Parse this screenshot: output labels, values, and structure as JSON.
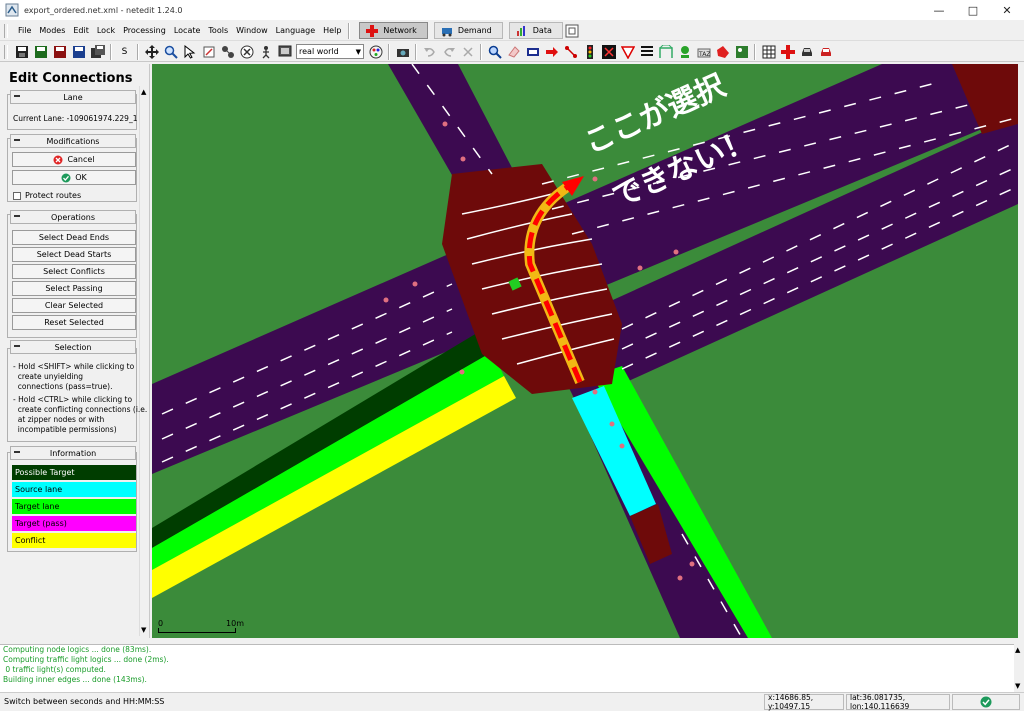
{
  "window": {
    "title": "export_ordered.net.xml - netedit 1.24.0",
    "controls": [
      "minimize-icon",
      "maximize-icon",
      "close-icon"
    ]
  },
  "menu": {
    "items": [
      "File",
      "Modes",
      "Edit",
      "Lock",
      "Processing",
      "Locate",
      "Tools",
      "Window",
      "Language",
      "Help"
    ],
    "underline": [
      "F",
      "M",
      "E",
      "L",
      "P",
      "L",
      "T",
      "W",
      "",
      "H"
    ],
    "modes": [
      {
        "label": "Network",
        "active": true
      },
      {
        "label": "Demand",
        "active": false
      },
      {
        "label": "Data",
        "active": false
      }
    ]
  },
  "toolbar": {
    "seconds_button": "S",
    "viewport_select": "real world"
  },
  "panel": {
    "title": "Edit Connections",
    "lane_header": "Lane",
    "current_lane": "Current Lane: -109061974.229_1",
    "modifications_header": "Modifications",
    "cancel_label": "Cancel",
    "ok_label": "OK",
    "protect_routes_label": "Protect routes",
    "operations_header": "Operations",
    "operations": [
      "Select Dead Ends",
      "Select Dead Starts",
      "Select Conflicts",
      "Select Passing",
      "Clear Selected",
      "Reset Selected"
    ],
    "selection_header": "Selection",
    "selection_help": [
      "- Hold <SHIFT> while clicking to",
      "  create unyielding",
      "  connections (pass=true).",
      "- Hold <CTRL> while clicking to",
      "  create conflicting connections (i.e.",
      "  at zipper nodes or with",
      "  incompatible permissions)"
    ],
    "information_header": "Information",
    "legend": [
      {
        "label": "Possible Target",
        "color": "#003d00",
        "text_color": "#ffffff"
      },
      {
        "label": "Source lane",
        "color": "#00ffff",
        "text_color": "#000000"
      },
      {
        "label": "Target lane",
        "color": "#00ff00",
        "text_color": "#000000"
      },
      {
        "label": "Target (pass)",
        "color": "#ff00ff",
        "text_color": "#000000"
      },
      {
        "label": "Conflict",
        "color": "#ffff00",
        "text_color": "#000000"
      }
    ]
  },
  "map": {
    "annotation_line1": "ここが選択",
    "annotation_line2": "できない！",
    "scale_zero": "0",
    "scale_label": "10m",
    "colors": {
      "background": "#3b8b3a",
      "road": "#3c0a50",
      "junction": "#6e0a0a",
      "source_lane": "#00ffff",
      "target_lane": "#00ff00",
      "possible_target": "#003d00",
      "conflict": "#ffff00",
      "arrow": "#ff0000",
      "arrow_fill": "#f2b814"
    }
  },
  "log": {
    "lines": [
      "Computing node logics ... done (83ms).",
      "Computing traffic light logics ... done (2ms).",
      " 0 traffic light(s) computed.",
      "Building inner edges ... done (143ms)."
    ]
  },
  "status": {
    "hint": "Switch between seconds and HH:MM:SS",
    "xy": "x:14686.85, y:10497.15",
    "latlon": "lat:36.081735, lon:140.116639"
  }
}
